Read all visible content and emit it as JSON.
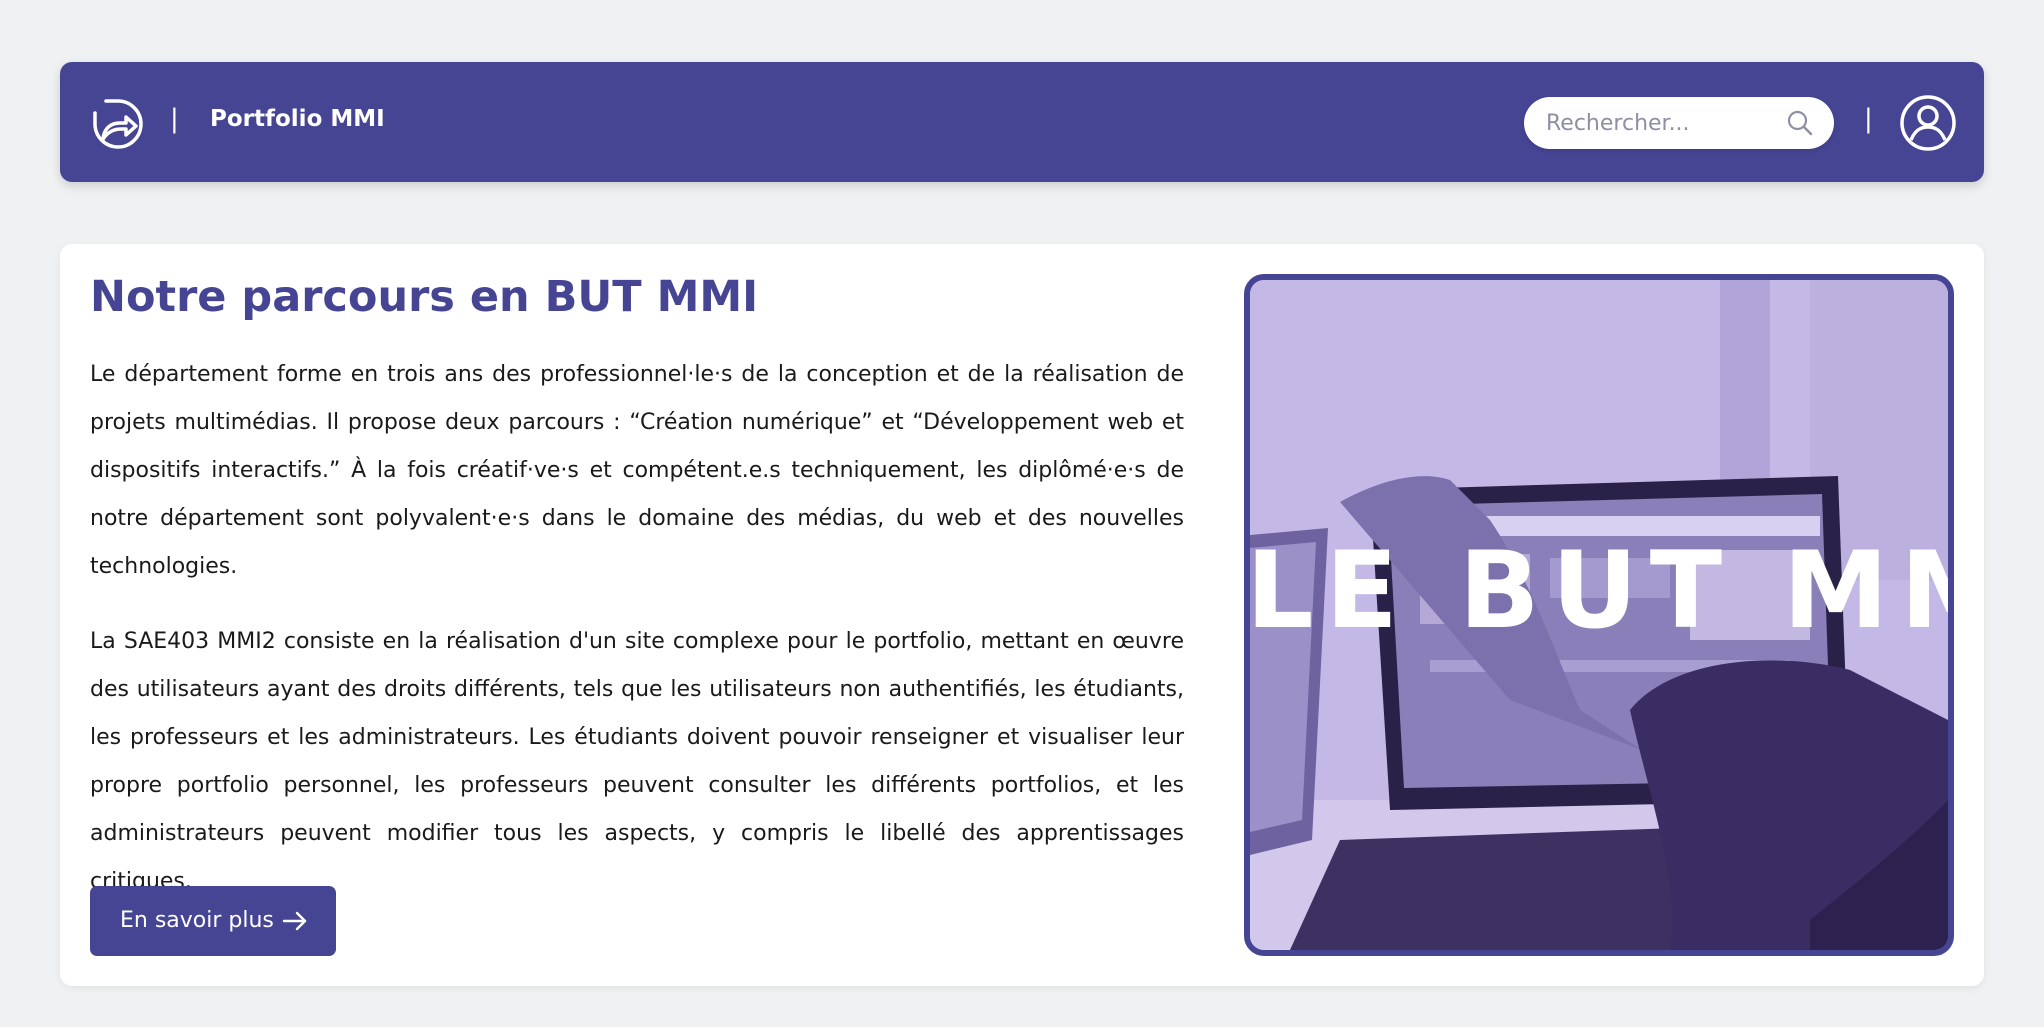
{
  "header": {
    "logo_icon": "arrow-circle-logo-icon",
    "separator": "|",
    "site_title": "Portfolio MMI",
    "search": {
      "placeholder": "Rechercher...",
      "value": "",
      "icon": "search-icon"
    },
    "user_icon": "user-account-icon"
  },
  "main": {
    "title": "Notre parcours en BUT MMI",
    "paragraphs": [
      "Le département forme en trois ans des professionnel·le·s de la conception et de la réalisation de projets multimédias. Il propose deux parcours : “Création numérique” et “Développement web et dispositifs interactifs.” À la fois créatif·ve·s et compétent.e.s techniquement, les diplômé·e·s de notre département sont polyvalent·e·s dans le domaine des médias, du web et des nouvelles technologies.",
      "La SAE403 MMI2 consiste en la réalisation d'un site complexe pour le portfolio, mettant en œuvre des utilisateurs ayant des droits différents, tels que les utilisateurs non authentifiés, les étudiants, les professeurs et les administrateurs. Les étudiants doivent pouvoir renseigner et visualiser leur propre portfolio personnel, les professeurs peuvent consulter les différents portfolios, et les administrateurs peuvent modifier tous les aspects, y compris le libellé des apprentissages critiques."
    ],
    "cta": {
      "label": "En savoir plus",
      "icon": "arrow-right-icon"
    },
    "hero_image": {
      "overlay_text": "LE BUT MMI"
    }
  },
  "colors": {
    "primary": "#464593",
    "background": "#eff1f2",
    "card": "#ffffff",
    "hero_tint": "#b8ade0"
  }
}
